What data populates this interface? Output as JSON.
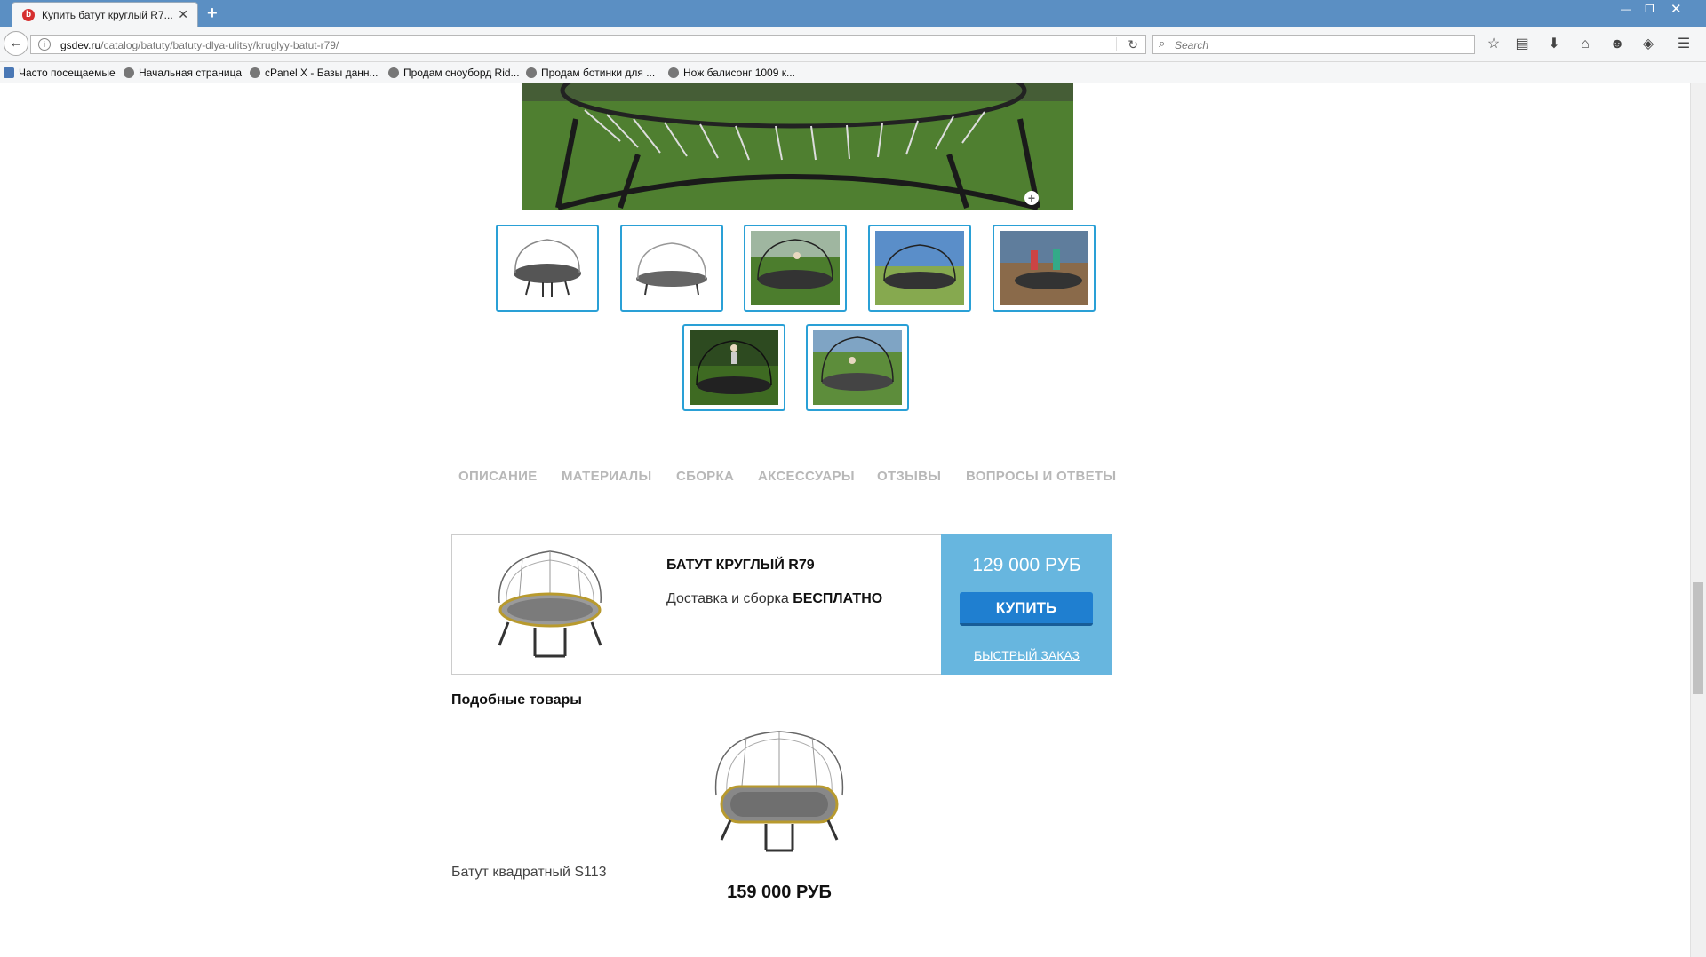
{
  "browser": {
    "tab_title": "Купить батут круглый R7...",
    "url_host": "gsdev.ru",
    "url_path": "/catalog/batuty/batuty-dlya-ulitsy/kruglyy-batut-r79/",
    "search_placeholder": "Search",
    "bookmarks": [
      "Часто посещаемые",
      "Начальная страница",
      "cPanel X - Базы данн...",
      "Продам сноуборд Rid...",
      "Продам ботинки для ...",
      "Нож балисонг 1009 к..."
    ]
  },
  "product_tabs": [
    "ОПИСАНИЕ",
    "МАТЕРИАЛЫ",
    "СБОРКА",
    "АКСЕССУАРЫ",
    "ОТЗЫВЫ",
    "ВОПРОСЫ И ОТВЕТЫ"
  ],
  "buybox": {
    "title": "БАТУТ КРУГЛЫЙ R79",
    "delivery_prefix": "Доставка и сборка",
    "delivery_bold": "БЕСПЛАТНО",
    "price": "129 000 РУБ",
    "buy_label": "КУПИТЬ",
    "quick_order_label": "БЫСТРЫЙ ЗАКАЗ"
  },
  "similar": {
    "heading": "Подобные товары",
    "item_name": "Батут квадратный S113",
    "item_price": "159 000 РУБ"
  },
  "colors": {
    "accent_blue": "#2aa0d6",
    "price_panel": "#67b6df",
    "buy_button": "#1f7fd0",
    "tab_text": "#b8b8b8"
  }
}
